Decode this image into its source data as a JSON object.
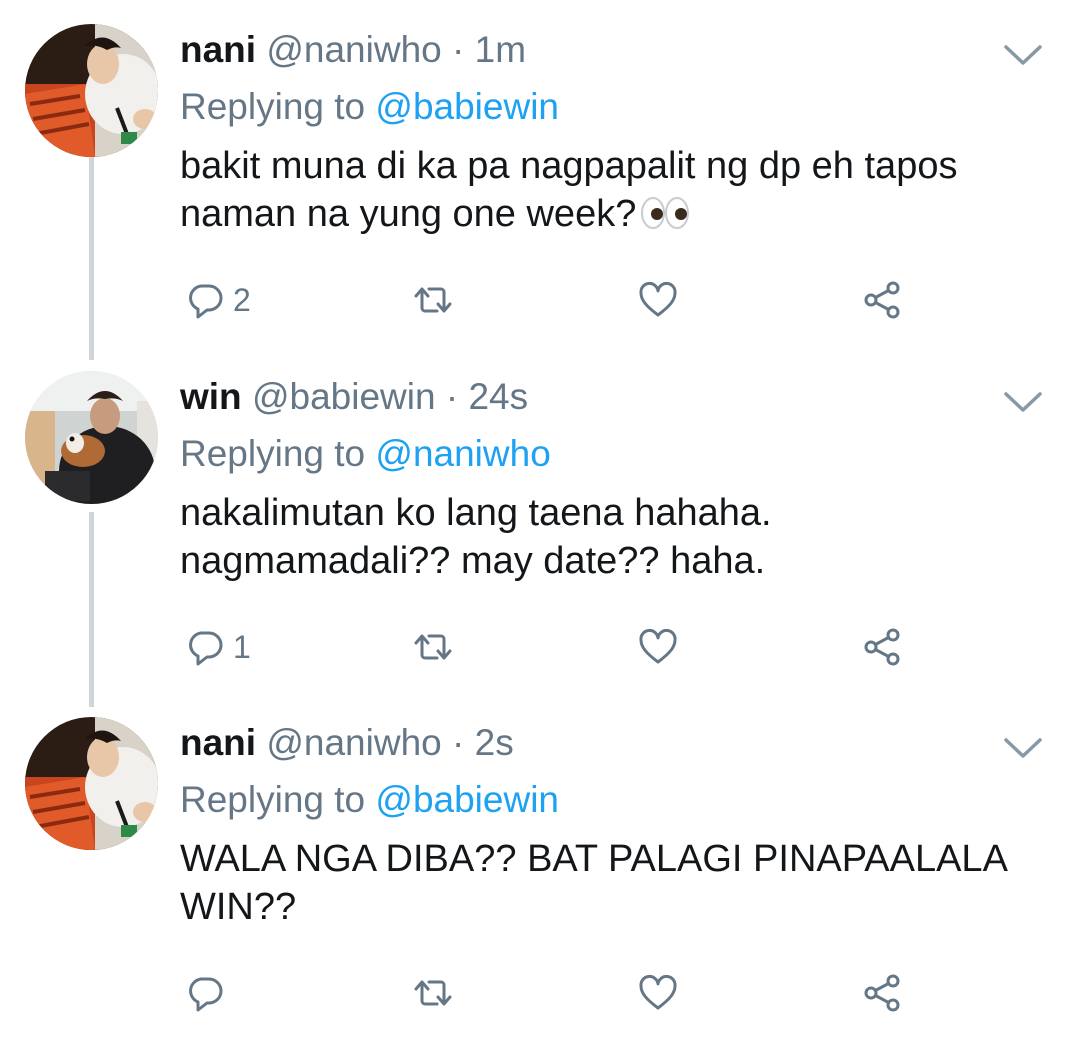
{
  "tweets": [
    {
      "name": "nani",
      "handle": "@naniwho",
      "separator": "·",
      "time": "1m",
      "replying_prefix": "Replying to ",
      "replying_to": "@babiewin",
      "text": "bakit muna di ka pa nagpapalit ng dp eh tapos naman na yung one week?",
      "emoji": "eyes-emoji",
      "reply_count": "2",
      "avatar_icon": "avatar-nani"
    },
    {
      "name": "win",
      "handle": "@babiewin",
      "separator": "·",
      "time": "24s",
      "replying_prefix": "Replying to ",
      "replying_to": "@naniwho",
      "text": "nakalimutan ko lang taena hahaha. nagmamadali?? may date?? haha.",
      "reply_count": "1",
      "avatar_icon": "avatar-win"
    },
    {
      "name": "nani",
      "handle": "@naniwho",
      "separator": "·",
      "time": "2s",
      "replying_prefix": "Replying to ",
      "replying_to": "@babiewin",
      "text": "WALA NGA DIBA?? BAT PALAGI PINAPAALALA WIN??",
      "reply_count": "",
      "avatar_icon": "avatar-nani"
    }
  ],
  "icons": {
    "reply": "reply-icon",
    "retweet": "retweet-icon",
    "like": "heart-icon",
    "share": "share-icon",
    "caret": "chevron-down-icon"
  },
  "colors": {
    "link": "#1da1f2",
    "secondary": "#657786",
    "text": "#14171a",
    "thread_line": "#cfd5da"
  }
}
